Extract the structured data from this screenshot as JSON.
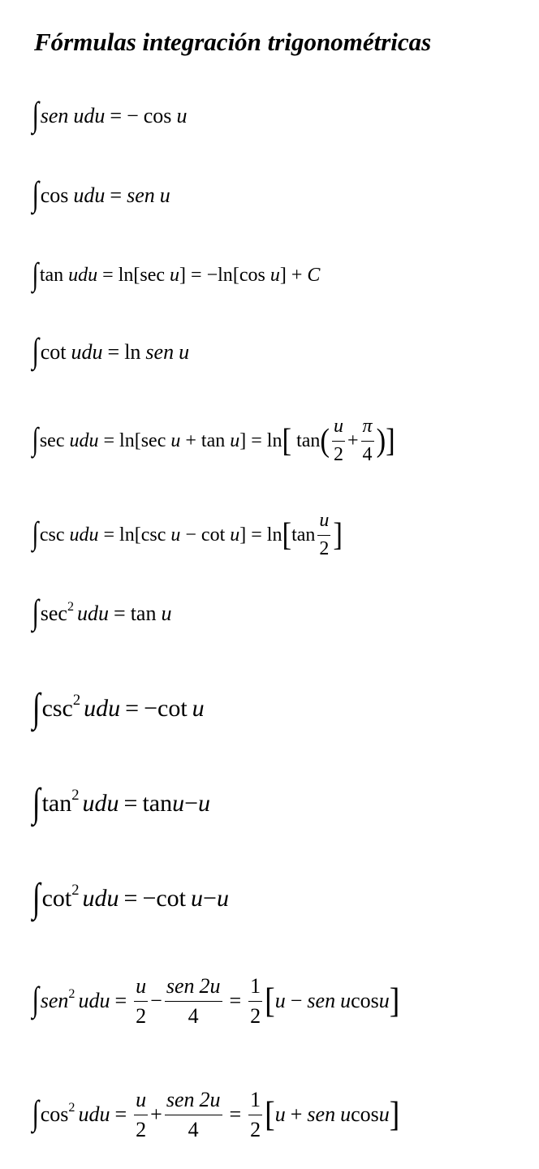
{
  "page": {
    "title": "Fórmulas integración trigonométricas"
  },
  "symbols": {
    "integral": "∫",
    "equals": "=",
    "minus": "−",
    "plus": "+",
    "u": "u",
    "du": "du",
    "udu": "udu",
    "sen": "sen",
    "cos": "cos",
    "tan": "tan",
    "cot": "cot",
    "sec": "sec",
    "csc": "csc",
    "ln": "ln",
    "C": "C",
    "pi": "π",
    "two": "2",
    "four": "4",
    "one": "1",
    "two_u": "2u",
    "lbr": "[",
    "rbr": "]",
    "lpar": "(",
    "rpar": ")"
  }
}
